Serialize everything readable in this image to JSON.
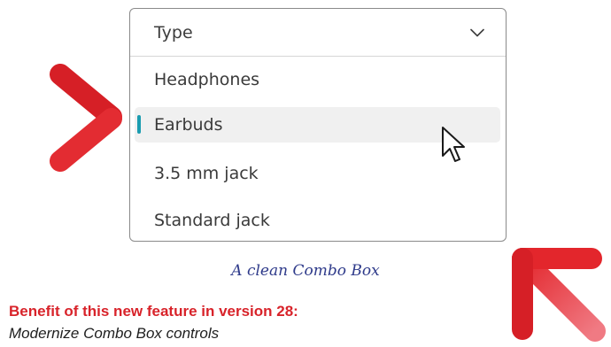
{
  "combo_box": {
    "header_label": "Type",
    "options": [
      {
        "label": "Headphones",
        "selected": false
      },
      {
        "label": "Earbuds",
        "selected": true
      },
      {
        "label": "3.5 mm jack",
        "selected": false
      },
      {
        "label": "Standard jack",
        "selected": false
      }
    ],
    "selection_indicator_color": "#1a9cb0"
  },
  "caption": "A clean Combo Box",
  "benefit": {
    "title": "Benefit of this new feature in version 28:",
    "description": "Modernize Combo Box controls"
  },
  "colors": {
    "accent_red": "#e3262c",
    "caption_blue": "#2e3a8a",
    "title_red": "#d8232a"
  },
  "icons": [
    "chevron-down-icon",
    "mouse-cursor-icon",
    "arrow-right-icon",
    "arrow-up-left-icon"
  ]
}
